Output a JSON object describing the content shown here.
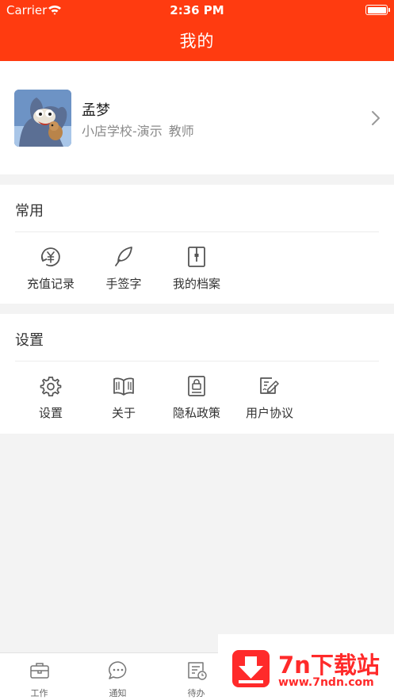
{
  "status_bar": {
    "carrier": "Carrier",
    "time": "2:36 PM"
  },
  "header": {
    "title": "我的"
  },
  "profile": {
    "name": "孟梦",
    "school": "小店学校-演示",
    "role": "教师"
  },
  "common": {
    "title": "常用",
    "items": [
      {
        "label": "充值记录",
        "icon": "yen-circle-icon"
      },
      {
        "label": "手签字",
        "icon": "feather-pen-icon"
      },
      {
        "label": "我的档案",
        "icon": "archive-folder-icon"
      }
    ]
  },
  "settings": {
    "title": "设置",
    "items": [
      {
        "label": "设置",
        "icon": "gear-icon"
      },
      {
        "label": "关于",
        "icon": "open-book-icon"
      },
      {
        "label": "隐私政策",
        "icon": "lock-document-icon"
      },
      {
        "label": "用户协议",
        "icon": "signed-document-icon"
      }
    ]
  },
  "tabbar": {
    "items": [
      {
        "label": "工作",
        "icon": "briefcase-icon"
      },
      {
        "label": "通知",
        "icon": "chat-bubble-icon"
      },
      {
        "label": "待办",
        "icon": "todo-clock-icon"
      }
    ]
  },
  "watermark": {
    "title": "7n下载站",
    "url": "www.7ndn.com"
  },
  "colors": {
    "brand": "#ff3b10",
    "watermark": "#ff2a2a"
  }
}
